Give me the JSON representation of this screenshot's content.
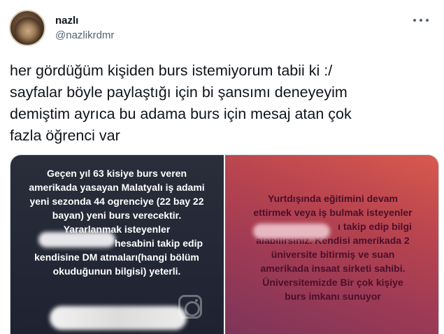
{
  "author": {
    "display_name": "nazlı",
    "handle": "@nazlikrdmr"
  },
  "menu": {
    "icon": "more-horizontal-icon"
  },
  "tweet": {
    "lines": [
      "her gördüğüm kişiden burs istemiyorum tabii ki :/",
      "sayfalar böyle paylaştığı için bi şansımı deneyeyim",
      "demiştim ayrıca bu adama burs için mesaj atan çok",
      "fazla öğrenci var"
    ]
  },
  "media": {
    "left_caption": [
      "Geçen yıl  63 kisiye burs veren",
      "amerikada yasayan Malatyalı iş adami",
      "yeni sezonda 44 ogrenciye (22 bay 22",
      "bayan) yeni burs verecektir.",
      "Yararlanmak isteyenler",
      "hesabini takip edip",
      "kendisine DM atmaları(hangi bölüm",
      "okuduğunun bilgisi) yeterli."
    ],
    "right_caption": [
      "Yurtdışında eğitimini devam",
      "ettirmek veya iş bulmak isteyenler",
      "ı takip edip bilgi",
      "alabilirsiniz. Kendisi amerikada 2",
      "üniversite bitirmiş ve suan",
      "amerikada insaat sirketi sahibi.",
      "Üniversitemizde Bir çok kişiye",
      "burs imkanı sunuyor"
    ],
    "colors": {
      "left_bg": "#242836",
      "right_bg": "#b8444f",
      "right_text": "#4a0f2a"
    },
    "camera_icon": "instagram-camera-icon"
  }
}
